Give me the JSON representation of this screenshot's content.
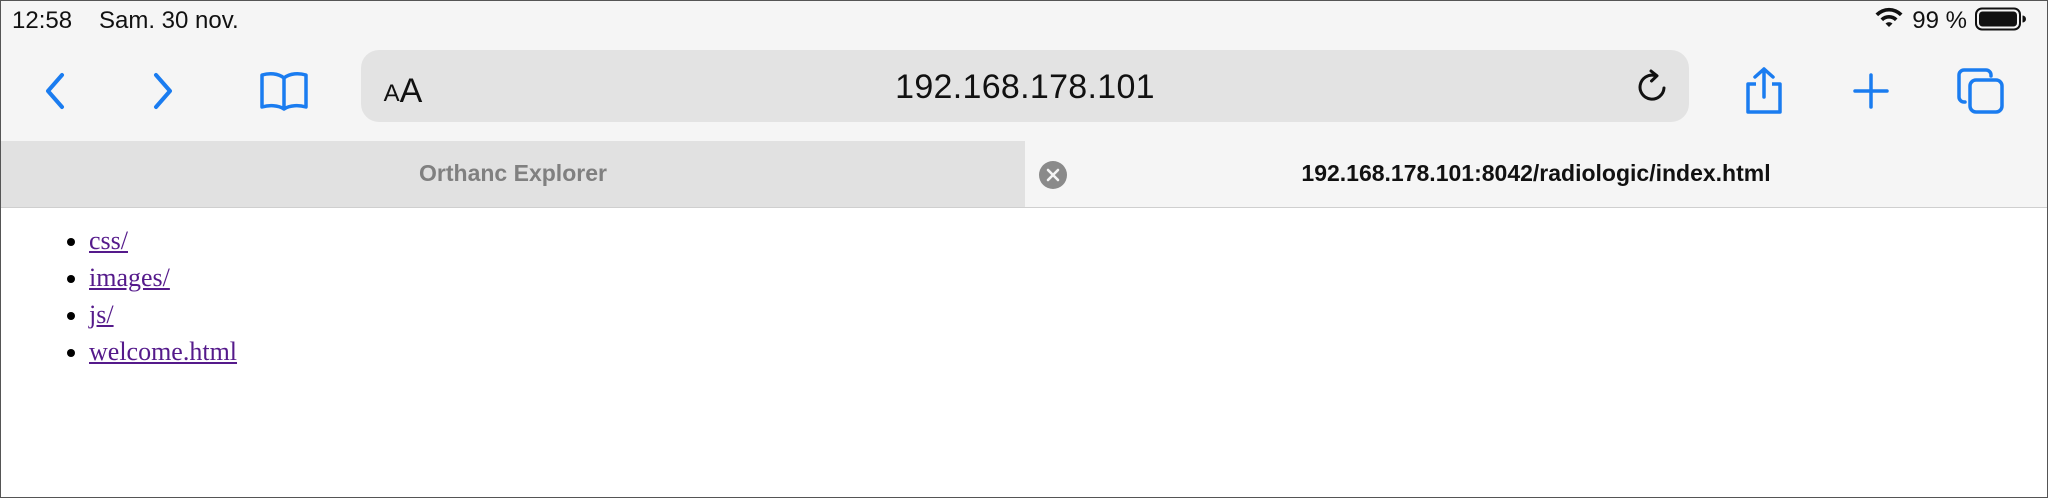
{
  "status_bar": {
    "time": "12:58",
    "date": "Sam. 30 nov.",
    "battery": "99 %"
  },
  "toolbar": {
    "text_size_small": "A",
    "text_size_big": "A",
    "url": "192.168.178.101",
    "accent_color": "#1a7cf0"
  },
  "tabs": [
    {
      "title": "Orthanc Explorer",
      "active": false
    },
    {
      "title": "192.168.178.101:8042/radiologic/index.html",
      "active": true
    }
  ],
  "page": {
    "links": [
      {
        "label": "css/"
      },
      {
        "label": "images/"
      },
      {
        "label": "js/"
      },
      {
        "label": "welcome.html"
      }
    ],
    "visited_link_color": "#551a8b"
  }
}
